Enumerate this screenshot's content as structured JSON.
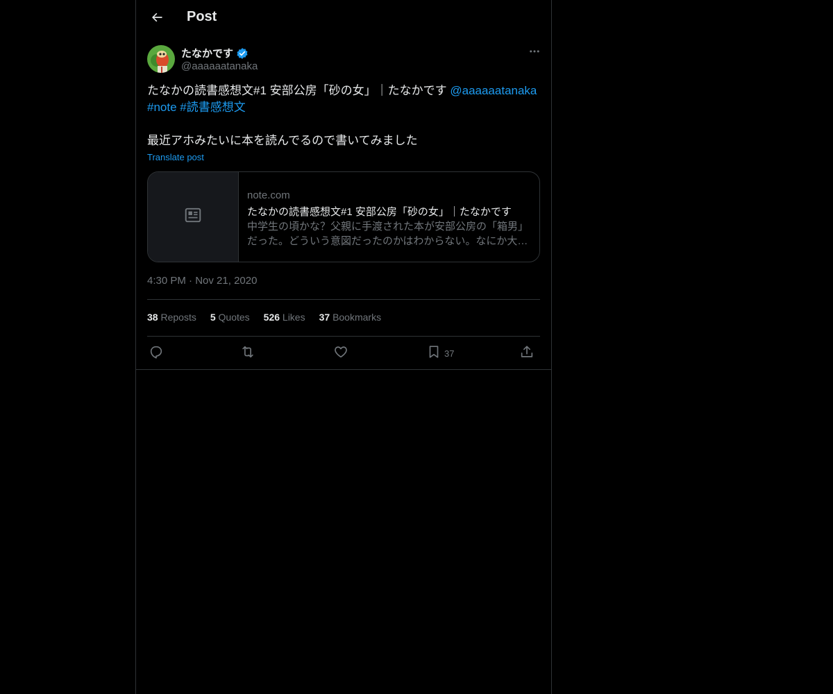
{
  "header": {
    "title": "Post"
  },
  "author": {
    "name": "たなかです",
    "handle": "@aaaaaatanaka"
  },
  "post": {
    "line1_text": "たなかの読書感想文#1 安部公房「砂の女」｜たなかです ",
    "line1_mention": "@aaaaaatanaka",
    "hashtag1": "#note",
    "hashtag2": "#読書感想文",
    "paragraph2": "最近アホみたいに本を読んでるので書いてみました",
    "translate_label": "Translate post"
  },
  "card": {
    "domain": "note.com",
    "title": "たなかの読書感想文#1 安部公房「砂の女」｜たなかです",
    "description": "中学生の頃かな？父親に手渡された本が安部公房の「箱男」だった。どういう意図だったのかはわからない。なにか大きな意味があったのかもしれない。"
  },
  "timestamp": {
    "time": "4:30 PM",
    "separator": "·",
    "date": "Nov 21, 2020"
  },
  "stats": {
    "reposts_count": "38",
    "reposts_label": "Reposts",
    "quotes_count": "5",
    "quotes_label": "Quotes",
    "likes_count": "526",
    "likes_label": "Likes",
    "bookmarks_count": "37",
    "bookmarks_label": "Bookmarks"
  },
  "actions": {
    "bookmark_count": "37"
  },
  "icons": {
    "back": "arrow-left-icon",
    "verified": "verified-badge-icon",
    "more": "more-icon",
    "card_placeholder": "article-icon",
    "reply": "reply-icon",
    "repost": "repost-icon",
    "like": "heart-icon",
    "bookmark": "bookmark-icon",
    "share": "share-icon"
  },
  "colors": {
    "background": "#000000",
    "text": "#e7e9ea",
    "muted": "#71767b",
    "link": "#1d9bf0",
    "border": "#2f3336"
  }
}
